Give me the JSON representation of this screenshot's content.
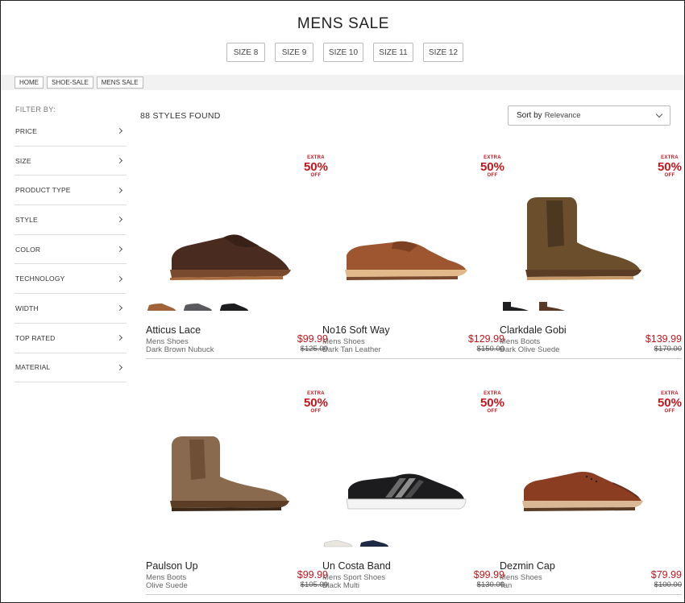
{
  "page": {
    "title": "MENS SALE"
  },
  "sizes": [
    "SIZE 8",
    "SIZE 9",
    "SIZE 10",
    "SIZE 11",
    "SIZE 12"
  ],
  "breadcrumb": [
    "HOME",
    "SHOE-SALE",
    "MENS SALE"
  ],
  "filters": {
    "heading": "FILTER BY:",
    "items": [
      "PRICE",
      "SIZE",
      "PRODUCT TYPE",
      "STYLE",
      "COLOR",
      "TECHNOLOGY",
      "WIDTH",
      "TOP RATED",
      "MATERIAL"
    ]
  },
  "results": {
    "count_text": "88 STYLES FOUND"
  },
  "sort": {
    "label": "Sort by",
    "value": "Relevance"
  },
  "badge": {
    "line1": "EXTRA",
    "line2": "50%",
    "line3": "OFF"
  },
  "colors": {
    "sale_red": "#c4161c"
  },
  "products": [
    {
      "name": "Atticus Lace",
      "category": "Mens Shoes",
      "color": "Dark Brown Nubuck",
      "price": "$99.99",
      "was": "$125.00",
      "swatches": [
        "#a0643a",
        "#5a5a5e",
        "#1c1c1e"
      ]
    },
    {
      "name": "No16 Soft Way",
      "category": "Mens Shoes",
      "color": "Dark Tan Leather",
      "price": "$129.99",
      "was": "$150.00",
      "swatches": []
    },
    {
      "name": "Clarkdale Gobi",
      "category": "Mens Boots",
      "color": "Dark Olive Suede",
      "price": "$139.99",
      "was": "$170.00",
      "swatches": [
        "#1f1f21",
        "#5b3a27"
      ]
    },
    {
      "name": "Paulson Up",
      "category": "Mens Boots",
      "color": "Olive Suede",
      "price": "$99.99",
      "was": "$105.00",
      "swatches": []
    },
    {
      "name": "Un Costa Band",
      "category": "Mens Sport Shoes",
      "color": "Black Multi",
      "price": "$99.99",
      "was": "$130.00",
      "swatches": [
        "#e9e6df",
        "#1f2a44"
      ]
    },
    {
      "name": "Dezmin Cap",
      "category": "Mens Shoes",
      "color": "Tan",
      "price": "$79.99",
      "was": "$100.00",
      "swatches": []
    }
  ]
}
